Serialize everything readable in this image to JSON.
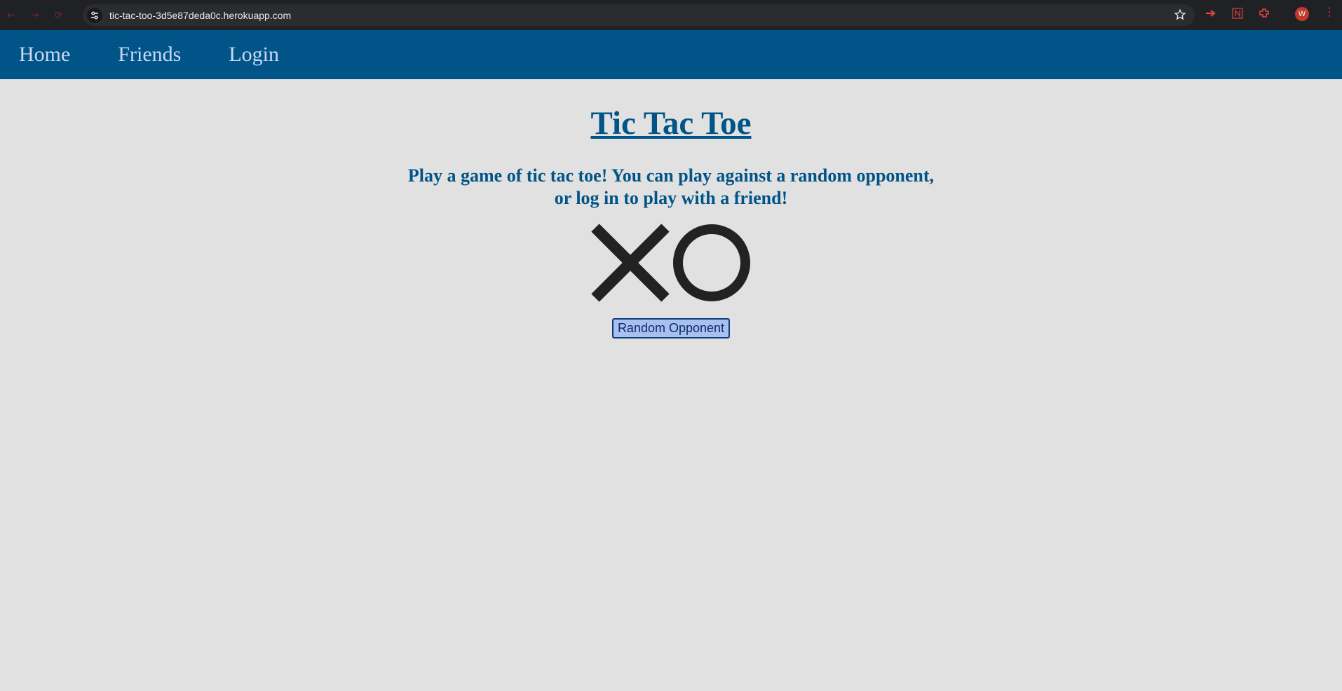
{
  "browser": {
    "url": "tic-tac-too-3d5e87deda0c.herokuapp.com",
    "avatar_letter": "W"
  },
  "nav": {
    "items": [
      {
        "label": "Home"
      },
      {
        "label": "Friends"
      },
      {
        "label": "Login"
      }
    ]
  },
  "main": {
    "title": "Tic Tac Toe",
    "intro_line1": "Play a game of tic tac toe! You can play against a random opponent,",
    "intro_line2": "or log in to play with a friend!",
    "random_button": "Random Opponent"
  },
  "colors": {
    "nav_bg": "#005487",
    "page_bg": "#e1e1e1",
    "accent": "#005487"
  }
}
